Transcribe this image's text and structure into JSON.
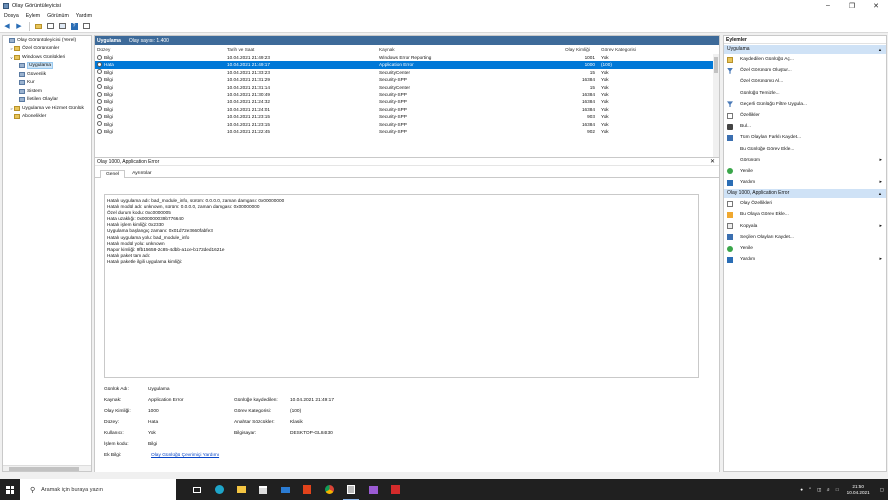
{
  "window": {
    "title": "Olay Görüntüleyicisi",
    "buttons": [
      "–",
      "❐",
      "✕"
    ]
  },
  "menu": [
    "Dosya",
    "Eylem",
    "Görünüm",
    "Yardım"
  ],
  "tree": [
    {
      "label": "Olay Görüntüleyicisi (Yerel)",
      "indent": 0,
      "expander": "",
      "icon": "logic"
    },
    {
      "label": "Özel Görünümler",
      "indent": 1,
      "expander": ">",
      "icon": "fold"
    },
    {
      "label": "Windows Günlükleri",
      "indent": 1,
      "expander": "v",
      "icon": "fold"
    },
    {
      "label": "Uygulama",
      "indent": 2,
      "expander": "",
      "icon": "logic",
      "selected": true
    },
    {
      "label": "Güvenlik",
      "indent": 2,
      "expander": "",
      "icon": "logic"
    },
    {
      "label": "Kur",
      "indent": 2,
      "expander": "",
      "icon": "logic"
    },
    {
      "label": "Sistem",
      "indent": 2,
      "expander": "",
      "icon": "logic"
    },
    {
      "label": "İletilen Olaylar",
      "indent": 2,
      "expander": "",
      "icon": "logic"
    },
    {
      "label": "Uygulama ve Hizmet Günlük",
      "indent": 1,
      "expander": ">",
      "icon": "fold"
    },
    {
      "label": "Abonelikler",
      "indent": 1,
      "expander": "",
      "icon": "fold"
    }
  ],
  "center": {
    "log_name": "Uygulama",
    "event_count": "Olay sayısı: 1.400",
    "columns": [
      "Düzey",
      "Tarih ve Saat",
      "Kaynak",
      "Olay Kimliği",
      "Görev Kategorisi"
    ],
    "rows": [
      {
        "level": "Bilgi",
        "datetime": "10.04.2021 21:49:23",
        "source": "Windows Error Reporting",
        "id": "1001",
        "category": "Yok"
      },
      {
        "level": "Hata",
        "datetime": "10.04.2021 21:49:17",
        "source": "Application Error",
        "id": "1000",
        "category": "(100)",
        "selected": true
      },
      {
        "level": "Bilgi",
        "datetime": "10.04.2021 21:33:23",
        "source": "SecurityCenter",
        "id": "15",
        "category": "Yok"
      },
      {
        "level": "Bilgi",
        "datetime": "10.04.2021 21:31:29",
        "source": "Security-SPP",
        "id": "16384",
        "category": "Yok"
      },
      {
        "level": "Bilgi",
        "datetime": "10.04.2021 21:31:14",
        "source": "SecurityCenter",
        "id": "15",
        "category": "Yok"
      },
      {
        "level": "Bilgi",
        "datetime": "10.04.2021 21:30:49",
        "source": "Security-SPP",
        "id": "16384",
        "category": "Yok"
      },
      {
        "level": "Bilgi",
        "datetime": "10.04.2021 21:24:32",
        "source": "Security-SPP",
        "id": "16384",
        "category": "Yok"
      },
      {
        "level": "Bilgi",
        "datetime": "10.04.2021 21:24:01",
        "source": "Security-SPP",
        "id": "16384",
        "category": "Yok"
      },
      {
        "level": "Bilgi",
        "datetime": "10.04.2021 21:23:15",
        "source": "Security-SPP",
        "id": "903",
        "category": "Yok"
      },
      {
        "level": "Bilgi",
        "datetime": "10.04.2021 21:23:15",
        "source": "Security-SPP",
        "id": "16384",
        "category": "Yok"
      },
      {
        "level": "Bilgi",
        "datetime": "10.04.2021 21:22:45",
        "source": "Security-SPP",
        "id": "902",
        "category": "Yok"
      }
    ]
  },
  "detail": {
    "title": "Olay 1000, Application Error",
    "close": "✕",
    "tabs": [
      "Genel",
      "Ayrıntılar"
    ],
    "description": [
      "Hatalı uygulama adı: bad_module_info, sürüm: 0.0.0.0, zaman damgası: 0x00000000",
      "Hatalı modül adı: unknown, sürüm: 0.0.0.0, zaman damgası: 0x00000000",
      "Özel durum kodu: 0xc0000005",
      "Hata uzaklığı: 0x000000039b776640",
      "Hatalı işlem kimliği: 0x2330",
      "Uygulama başlangıç zamanı: 0x01d72e3660fabfe3",
      "Hatalı uygulama yolu: bad_module_info",
      "Hatalı modül yolu: unknown",
      "Rapor kimliği: 9fb15658-2c85-4dbb-a1ce-b172ded1621e",
      "Hatalı paket tam adı:",
      "Hatalı paketle ilgili uygulama kimliği:"
    ],
    "props": {
      "log_name_label": "Günlük Adı:",
      "log_name": "Uygulama",
      "source_label": "Kaynak:",
      "source": "Application Error",
      "logged_label": "Günlüğe kaydedilen:",
      "logged": "10.04.2021 21:49:17",
      "event_id_label": "Olay Kimliği:",
      "event_id": "1000",
      "task_label": "Görev Kategorisi:",
      "task": "(100)",
      "level_label": "Düzey:",
      "level": "Hata",
      "keywords_label": "Anahtar Sözcükler:",
      "keywords": "Klasik",
      "user_label": "Kullanıcı:",
      "user": "Yok",
      "computer_label": "Bilgisayar:",
      "computer": "DESKTOP-GL84I30",
      "opcode_label": "İşlem kodu:",
      "opcode": "Bilgi",
      "more_label": "Ek Bilgi:",
      "more_link": "Olay Günlüğü Çevrimiçi Yardımı"
    }
  },
  "actions": {
    "title": "Eylemler",
    "section1": "Uygulama",
    "items1": [
      {
        "label": "Kaydedilen Günlüğü Aç...",
        "icon": "fold"
      },
      {
        "label": "Özel Görünüm Oluştur...",
        "icon": "funnel"
      },
      {
        "label": "Özel Görünümü Al...",
        "icon": ""
      },
      {
        "label": "Günlüğü Temizle...",
        "icon": ""
      },
      {
        "label": "Geçerli Günlüğü Filtre Uygula...",
        "icon": "funnel"
      },
      {
        "label": "Özellikler",
        "icon": "doc"
      },
      {
        "label": "Bul...",
        "icon": "binoc"
      },
      {
        "label": "Tüm Olayları Farklı Kaydet...",
        "icon": "save"
      },
      {
        "label": "Bu Günlüğe Görev Ekle...",
        "icon": ""
      },
      {
        "label": "Görünüm",
        "icon": "",
        "more": true
      },
      {
        "label": "Yenile",
        "icon": "refresh"
      },
      {
        "label": "Yardım",
        "icon": "help",
        "more": true
      }
    ],
    "section2": "Olay 1000, Application Error",
    "items2": [
      {
        "label": "Olay Özellikleri",
        "icon": "doc"
      },
      {
        "label": "Bu Olaya Görev Ekle...",
        "icon": "task"
      },
      {
        "label": "Kopyala",
        "icon": "copy",
        "more": true
      },
      {
        "label": "Seçilen Olayları Kaydet...",
        "icon": "save"
      },
      {
        "label": "Yenile",
        "icon": "refresh"
      },
      {
        "label": "Yardım",
        "icon": "help",
        "more": true
      }
    ]
  },
  "taskbar": {
    "search_placeholder": "Aramak için buraya yazın",
    "time": "21:50",
    "date": "10.04.2021"
  },
  "colors": {
    "accent": "#0078d7",
    "panel_header": "#3d6a99",
    "action_section": "#cfe2f6",
    "taskbar": "#202020"
  }
}
